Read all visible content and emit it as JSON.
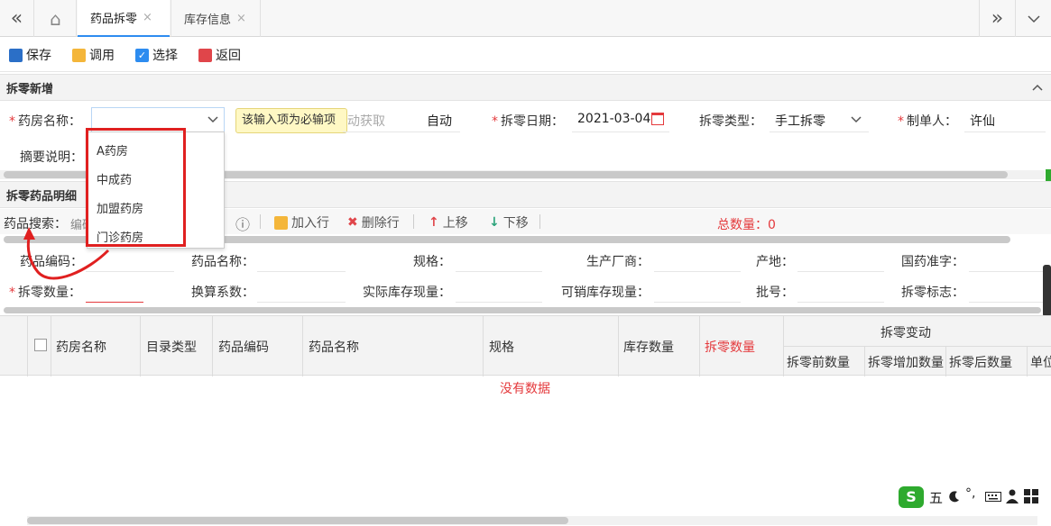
{
  "tabs": {
    "back_label": "«",
    "home_label": "⌂",
    "items": [
      {
        "label": "药品拆零",
        "close": "×"
      },
      {
        "label": "库存信息",
        "close": "×"
      }
    ],
    "forward_label": "»",
    "menu_label": "⌄"
  },
  "toolbar": {
    "save": "保存",
    "invoke": "调用",
    "select": "选择",
    "back": "返回"
  },
  "form_section": {
    "title": "拆零新增",
    "pharmacy_label": "药房名称：",
    "tooltip": "该输入项为必输项",
    "auto_fetch_partial": "动获取",
    "auto_value": "自动",
    "date_label": "拆零日期：",
    "date_value": "2021-03-04",
    "type_label": "拆零类型：",
    "type_value": "手工拆零",
    "maker_label": "制单人：",
    "maker_value": "许仙",
    "summary_label": "摘要说明："
  },
  "dropdown": {
    "options": [
      "A药房",
      "中成药",
      "加盟药房",
      "门诊药房"
    ]
  },
  "detail_section": {
    "title": "拆零药品明细",
    "search_label": "药品搜索：",
    "search_partial": "编码",
    "info_icon": "ⓘ",
    "add_row": "加入行",
    "delete_row": "删除行",
    "move_up": "上移",
    "move_down": "下移",
    "total_label": "总数量：",
    "total_value": "0"
  },
  "detail_fields": {
    "row1": [
      "药品编码：",
      "药品名称：",
      "规格：",
      "生产厂商：",
      "产地：",
      "国药准字："
    ],
    "row2": [
      "拆零数量：",
      "换算系数：",
      "实际库存现量：",
      "可销库存现量：",
      "批号：",
      "拆零标志："
    ]
  },
  "grid": {
    "headers": [
      "药房名称",
      "目录类型",
      "药品编码",
      "药品名称",
      "规格",
      "库存数量",
      "拆零数量"
    ],
    "group_header": "拆零变动",
    "sub_headers": [
      "拆零前数量",
      "拆零增加数量",
      "拆零后数量"
    ],
    "last_header_partial": "单位",
    "empty_text": "没有数据"
  },
  "ime": {
    "mode": "五"
  },
  "colors": {
    "accent": "#2d8cf0",
    "required": "#e4393c",
    "highlight": "#e02020",
    "tooltip_bg": "#fff8c4"
  }
}
